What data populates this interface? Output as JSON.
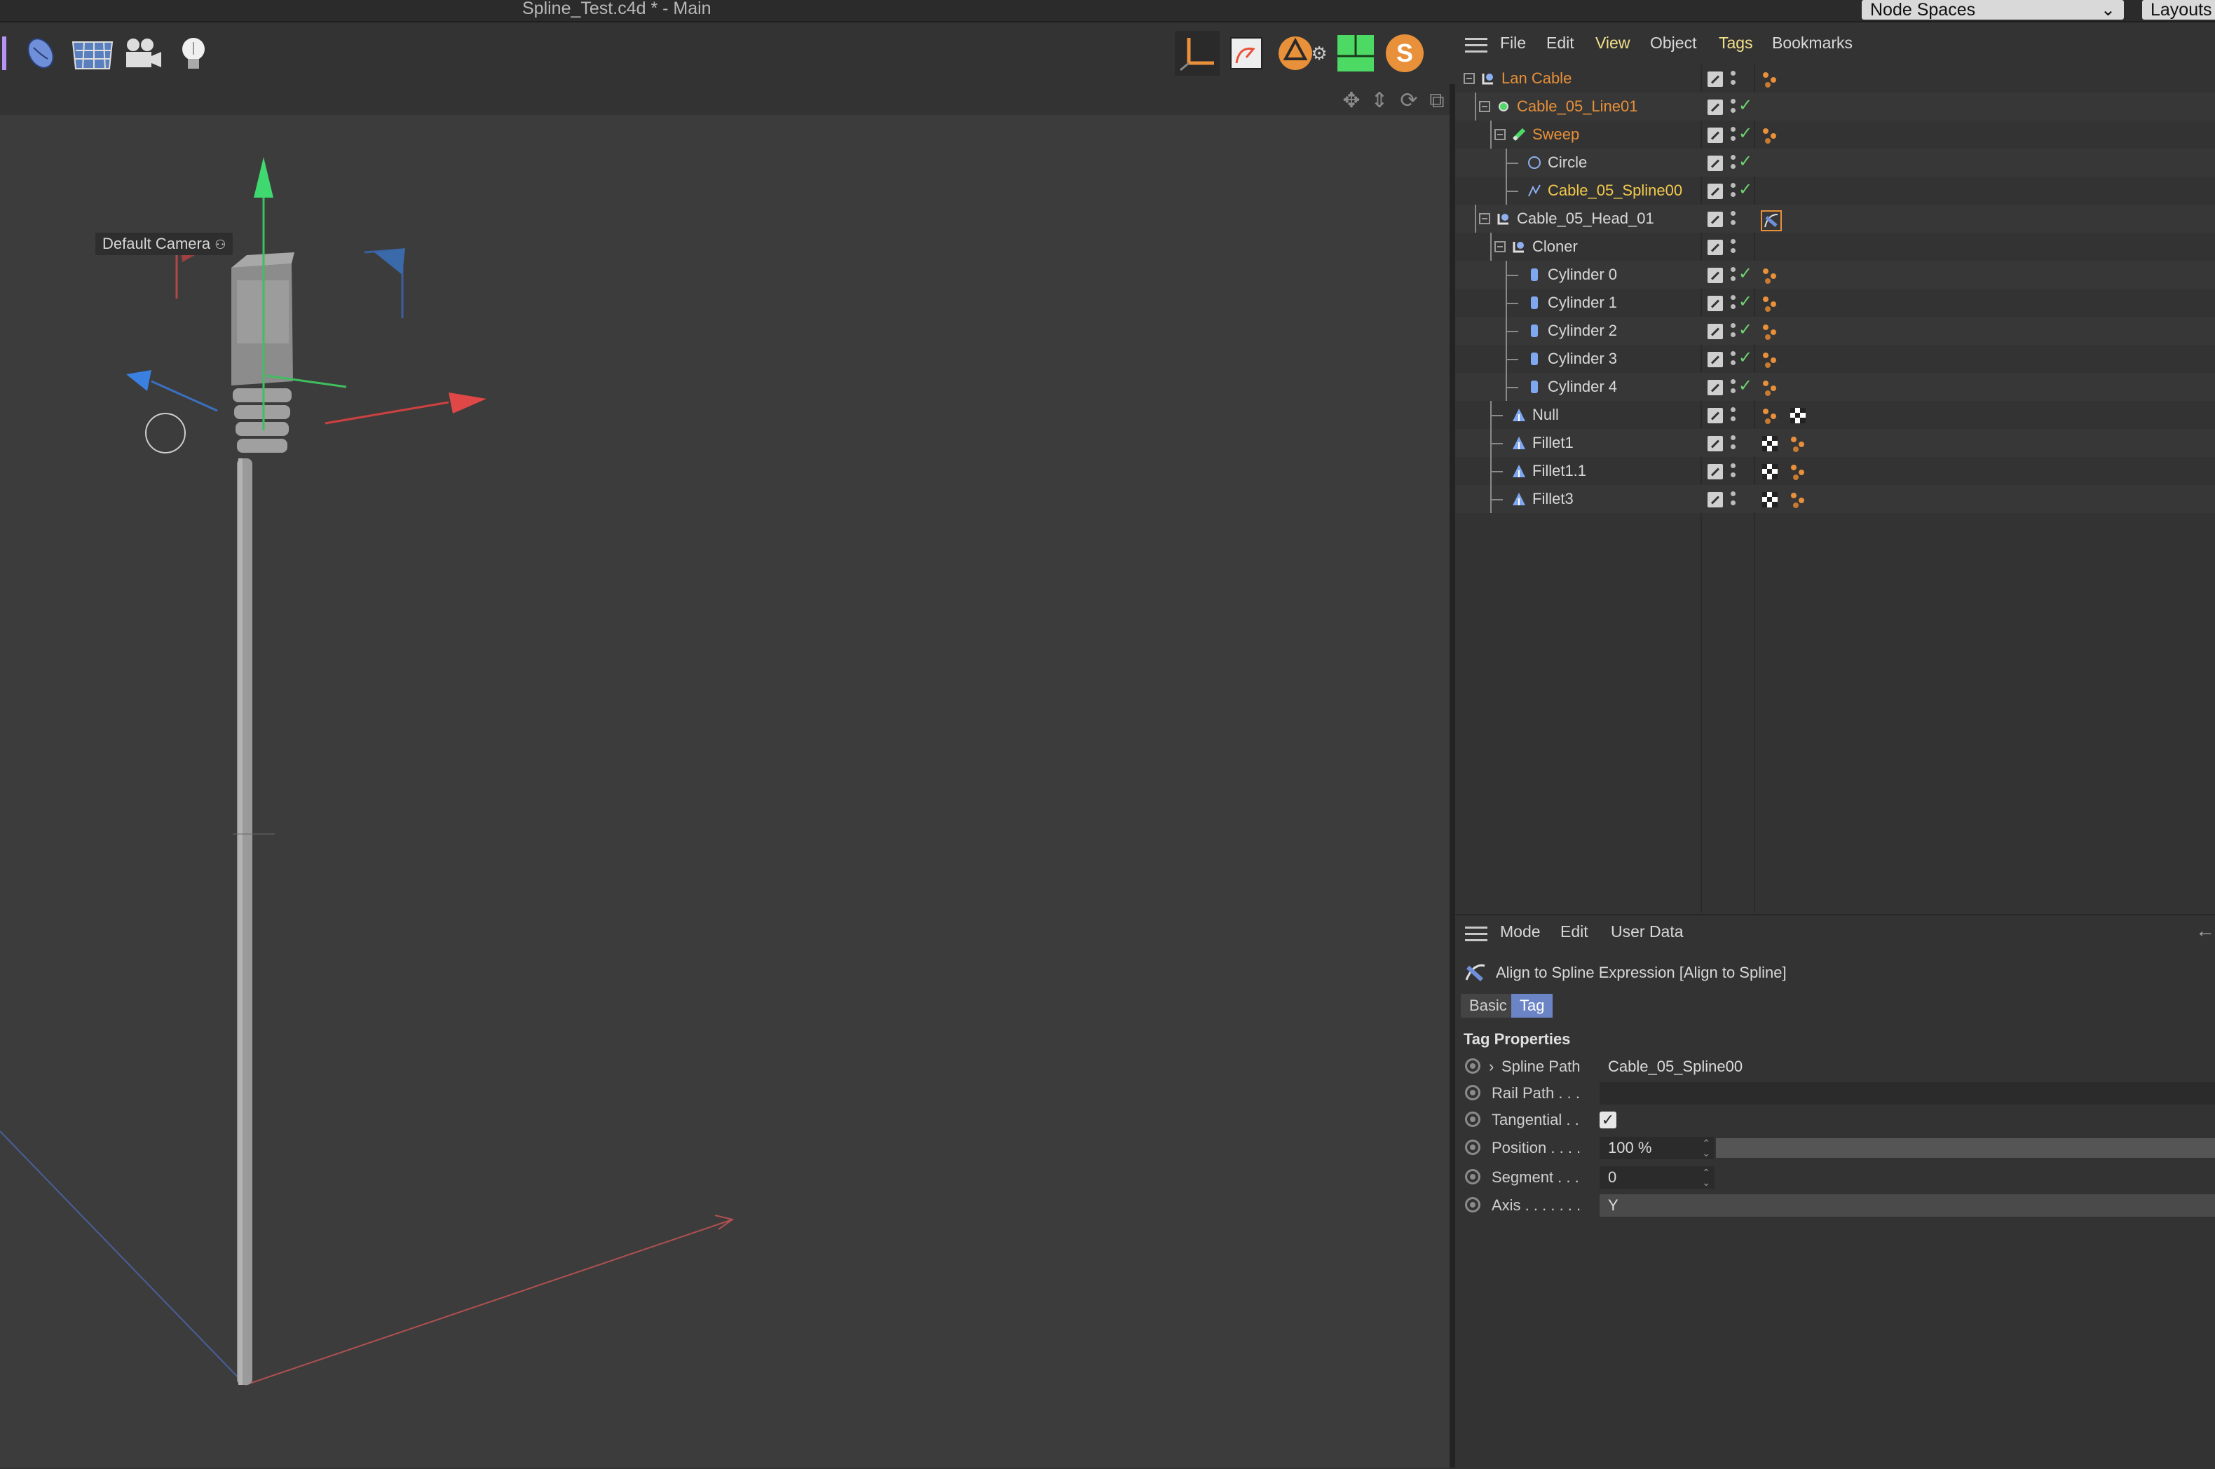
{
  "window": {
    "title": "Spline_Test.c4d * - Main"
  },
  "header_right": {
    "node_spaces": "Node Spaces",
    "layouts": "Layouts"
  },
  "viewport": {
    "camera_label": "Default Camera"
  },
  "object_manager": {
    "menu": [
      "File",
      "Edit",
      "View",
      "Object",
      "Tags",
      "Bookmarks"
    ],
    "objects": [
      {
        "name": "Lan Cable",
        "color": "#e8903a",
        "check": false,
        "tags": [
          "phong"
        ]
      },
      {
        "name": "Cable_05_Line01",
        "color": "#e8903a",
        "check": true,
        "tags": []
      },
      {
        "name": "Sweep",
        "color": "#e8903a",
        "check": true,
        "tags": [
          "phong"
        ]
      },
      {
        "name": "Circle",
        "color": "#d8d8d8",
        "check": true,
        "tags": []
      },
      {
        "name": "Cable_05_Spline00",
        "color": "#f2c94c",
        "check": true,
        "tags": []
      },
      {
        "name": "Cable_05_Head_01",
        "color": "#d8d8d8",
        "check": false,
        "tags": [
          "align-to-spline"
        ]
      },
      {
        "name": "Cloner",
        "color": "#d8d8d8",
        "check": false,
        "tags": []
      },
      {
        "name": "Cylinder 0",
        "color": "#d8d8d8",
        "check": true,
        "tags": [
          "phong"
        ]
      },
      {
        "name": "Cylinder 1",
        "color": "#d8d8d8",
        "check": true,
        "tags": [
          "phong"
        ]
      },
      {
        "name": "Cylinder 2",
        "color": "#d8d8d8",
        "check": true,
        "tags": [
          "phong"
        ]
      },
      {
        "name": "Cylinder 3",
        "color": "#d8d8d8",
        "check": true,
        "tags": [
          "phong"
        ]
      },
      {
        "name": "Cylinder 4",
        "color": "#d8d8d8",
        "check": true,
        "tags": [
          "phong"
        ]
      },
      {
        "name": "Null",
        "color": "#d8d8d8",
        "check": false,
        "tags": [
          "phong",
          "material"
        ]
      },
      {
        "name": "Fillet1",
        "color": "#d8d8d8",
        "check": false,
        "tags": [
          "material",
          "phong"
        ]
      },
      {
        "name": "Fillet1.1",
        "color": "#d8d8d8",
        "check": false,
        "tags": [
          "material",
          "phong"
        ]
      },
      {
        "name": "Fillet3",
        "color": "#d8d8d8",
        "check": false,
        "tags": [
          "material",
          "phong"
        ]
      }
    ]
  },
  "attribute_manager": {
    "menu": [
      "Mode",
      "Edit",
      "User Data"
    ],
    "title": "Align to Spline Expression [Align to Spline]",
    "tabs": [
      {
        "label": "Basic",
        "active": false
      },
      {
        "label": "Tag",
        "active": true
      }
    ],
    "section": "Tag Properties",
    "properties": [
      {
        "label": "Spline Path",
        "value": "Cable_05_Spline00"
      },
      {
        "label": "Rail Path . . .",
        "value": ""
      },
      {
        "label": "Tangential . .",
        "checked": true
      },
      {
        "label": "Position . . . .",
        "value": "100 %"
      },
      {
        "label": "Segment . . .",
        "value": "0"
      },
      {
        "label": "Axis . . . . . . .",
        "value": "Y"
      }
    ]
  }
}
